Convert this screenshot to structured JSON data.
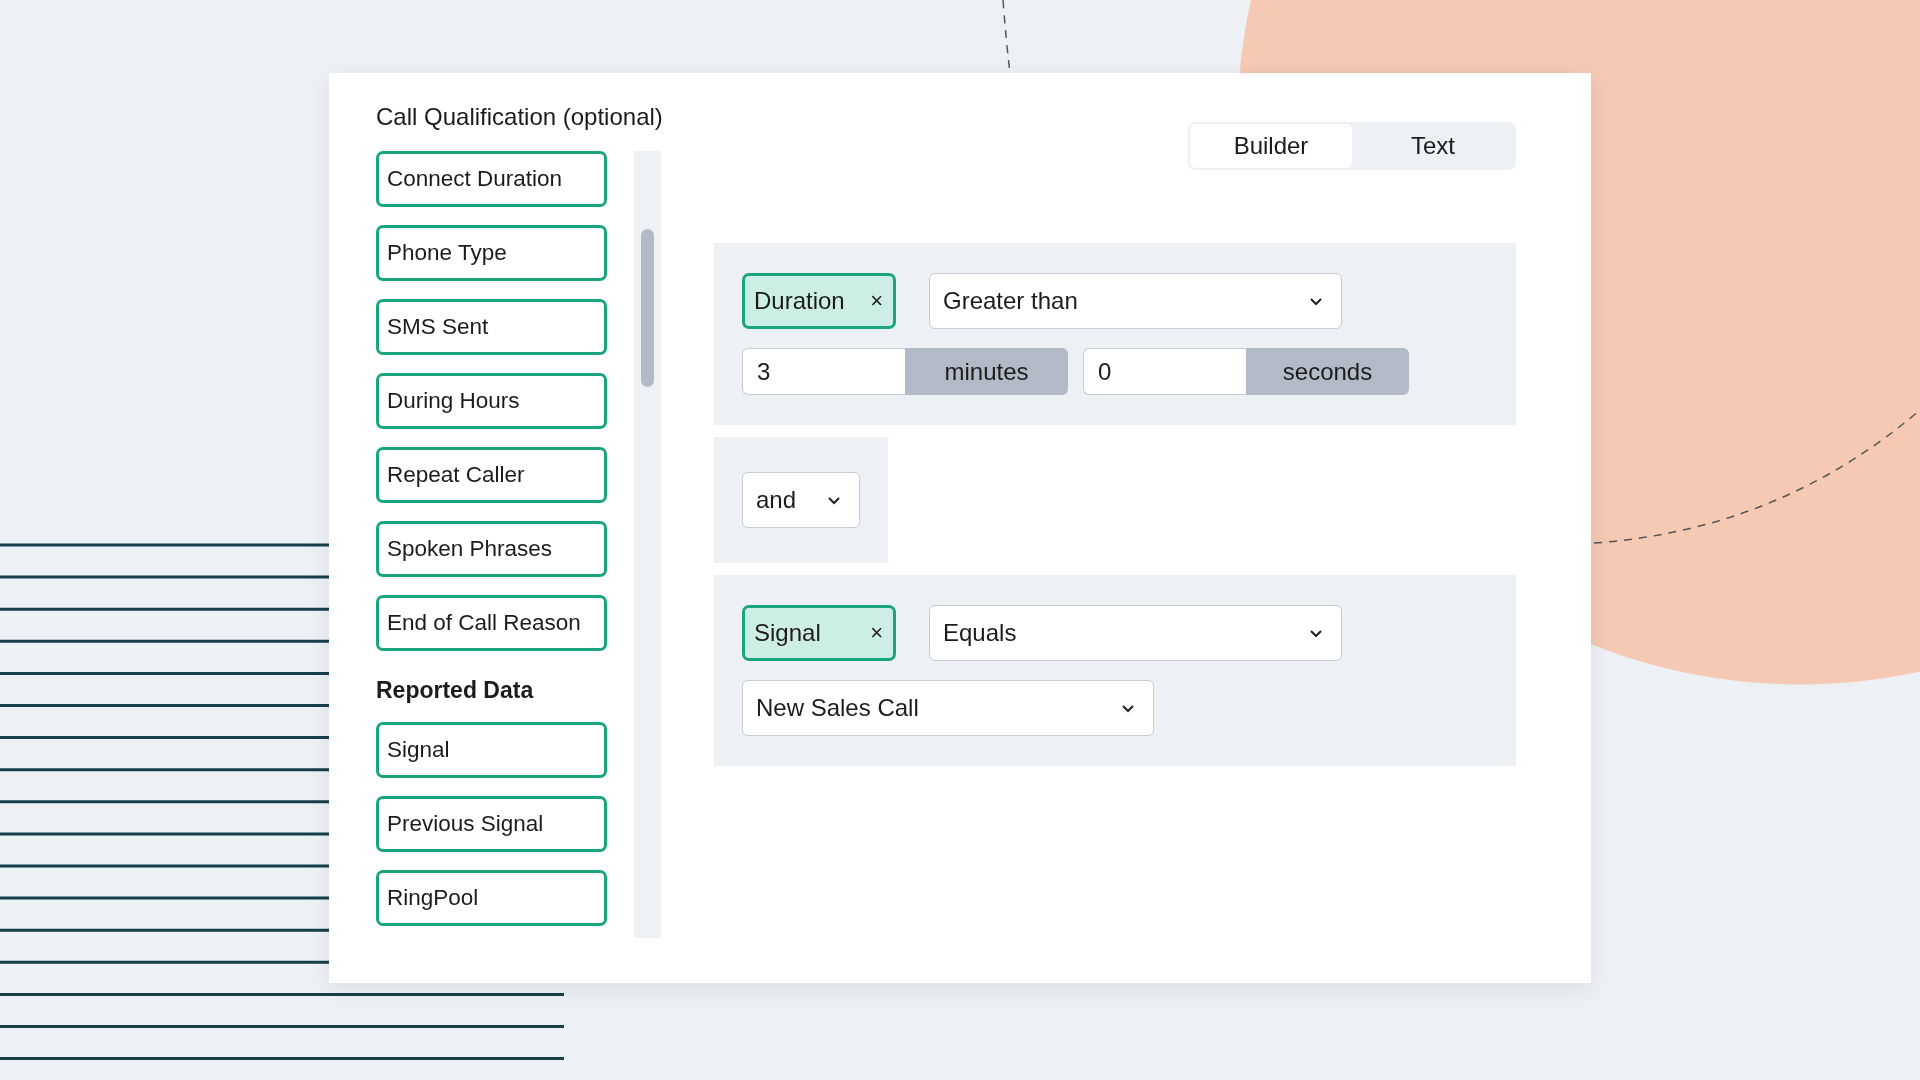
{
  "title": "Call Qualification (optional)",
  "fields": [
    "Connect Duration",
    "Phone Type",
    "SMS Sent",
    "During Hours",
    "Repeat Caller",
    "Spoken Phrases",
    "End of Call Reason"
  ],
  "reported_data": {
    "heading": "Reported Data",
    "fields": [
      "Signal",
      "Previous Signal",
      "RingPool"
    ]
  },
  "mode_tabs": [
    {
      "label": "Builder",
      "selected": true
    },
    {
      "label": "Text",
      "selected": false
    }
  ],
  "conditions": [
    {
      "kind": "duration",
      "chip": "Duration",
      "remove": "×",
      "operator": "Greater than",
      "inputs": [
        {
          "value": "3",
          "unit": "minutes"
        },
        {
          "value": "0",
          "unit": "seconds"
        }
      ]
    },
    {
      "kind": "connector",
      "operator": "and"
    },
    {
      "kind": "select",
      "chip": "Signal",
      "remove": "×",
      "operator": "Equals",
      "value": "New Sales Call"
    }
  ]
}
